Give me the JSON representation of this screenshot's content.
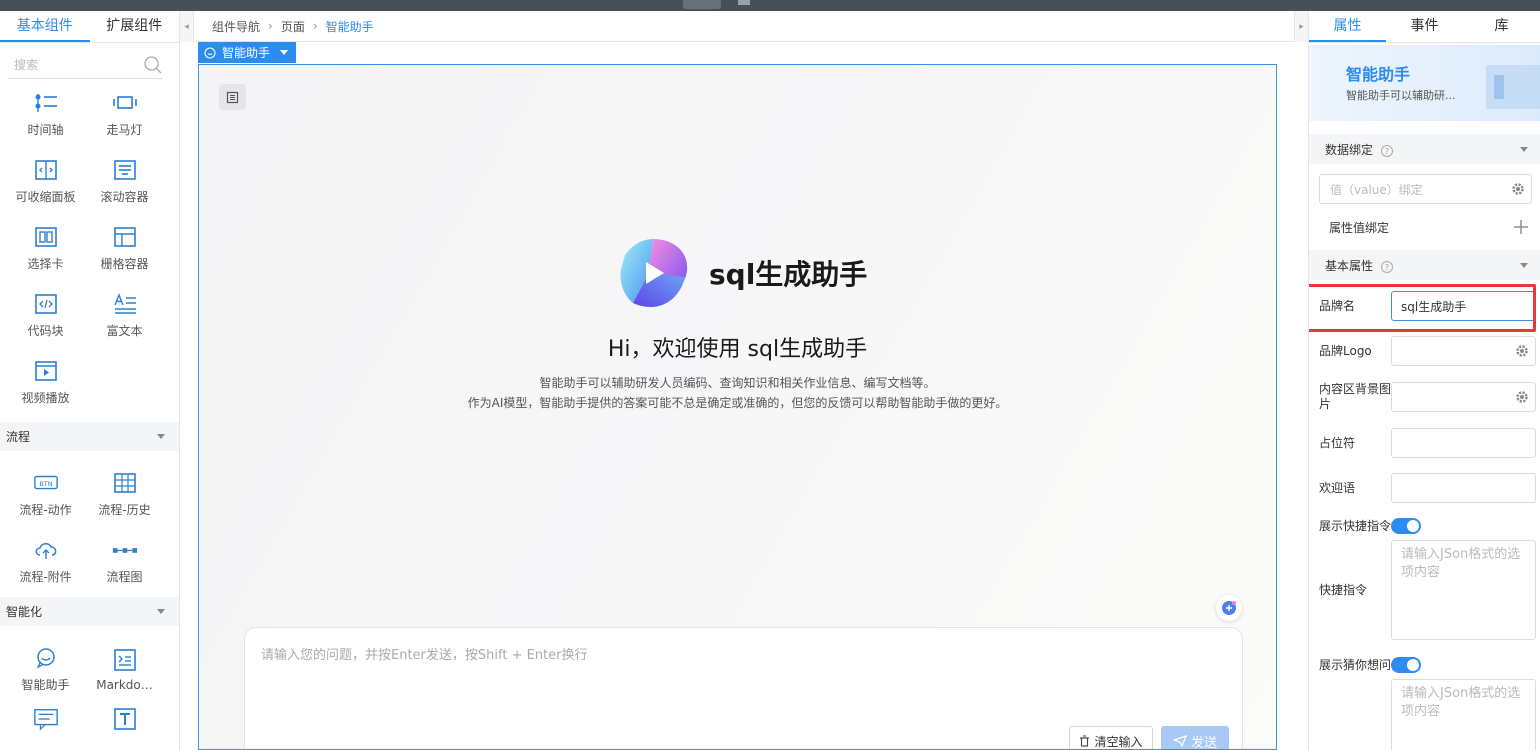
{
  "left_panel": {
    "tabs": [
      "基本组件",
      "扩展组件"
    ],
    "search_placeholder": "搜索",
    "basic": [
      {
        "label": "时间轴",
        "icon": "timeline-icon"
      },
      {
        "label": "走马灯",
        "icon": "carousel-icon"
      },
      {
        "label": "可收缩面板",
        "icon": "collapse-panel-icon"
      },
      {
        "label": "滚动容器",
        "icon": "scroll-container-icon"
      },
      {
        "label": "选择卡",
        "icon": "tabs-icon"
      },
      {
        "label": "栅格容器",
        "icon": "grid-container-icon"
      },
      {
        "label": "代码块",
        "icon": "code-block-icon"
      },
      {
        "label": "富文本",
        "icon": "rich-text-icon"
      },
      {
        "label": "视频播放",
        "icon": "video-player-icon"
      }
    ],
    "section_flow": "流程",
    "flow": [
      {
        "label": "流程-动作",
        "icon": "flow-action-icon"
      },
      {
        "label": "流程-历史",
        "icon": "flow-history-icon"
      },
      {
        "label": "流程-附件",
        "icon": "flow-attachment-icon"
      },
      {
        "label": "流程图",
        "icon": "flowchart-icon"
      }
    ],
    "section_ai": "智能化",
    "ai": [
      {
        "label": "智能助手",
        "icon": "smart-assistant-icon"
      },
      {
        "label": "Markdo…",
        "icon": "markdown-icon"
      }
    ]
  },
  "breadcrumb": [
    "组件导航",
    "页面",
    "智能助手"
  ],
  "canvas": {
    "component_tag": "智能助手",
    "brand_name": "sql生成助手",
    "welcome": "Hi，欢迎使用 sql生成助手",
    "desc_line1": "智能助手可以辅助研发人员编码、查询知识和相关作业信息、编写文档等。",
    "desc_line2": "作为AI模型，智能助手提供的答案可能不总是确定或准确的，但您的反馈可以帮助智能助手做的更好。",
    "input_placeholder": "请输入您的问题，并按Enter发送，按Shift + Enter换行",
    "clear_label": "清空输入",
    "send_label": "发送"
  },
  "right_panel": {
    "tabs": [
      "属性",
      "事件",
      "库"
    ],
    "banner_title": "智能助手",
    "banner_sub": "智能助手可以辅助研...",
    "section_binding": "数据绑定",
    "value_bind_placeholder": "值（value）绑定",
    "attr_bind_label": "属性值绑定",
    "section_basic": "基本属性",
    "brand_name_label": "品牌名",
    "brand_name_value": "sql生成助手",
    "brand_logo_label": "品牌Logo",
    "bg_image_label": "内容区背景图片",
    "placeholder_label": "占位符",
    "welcome_label": "欢迎语",
    "show_quick_label": "展示快捷指令",
    "quick_label": "快捷指令",
    "quick_placeholder": "请输入JSon格式的选项内容",
    "show_guess_label": "展示猜你想问",
    "guess_placeholder": "请输入JSon格式的选项内容"
  },
  "colors": {
    "accent": "#2d8cf0",
    "highlight": "#e5393a"
  }
}
